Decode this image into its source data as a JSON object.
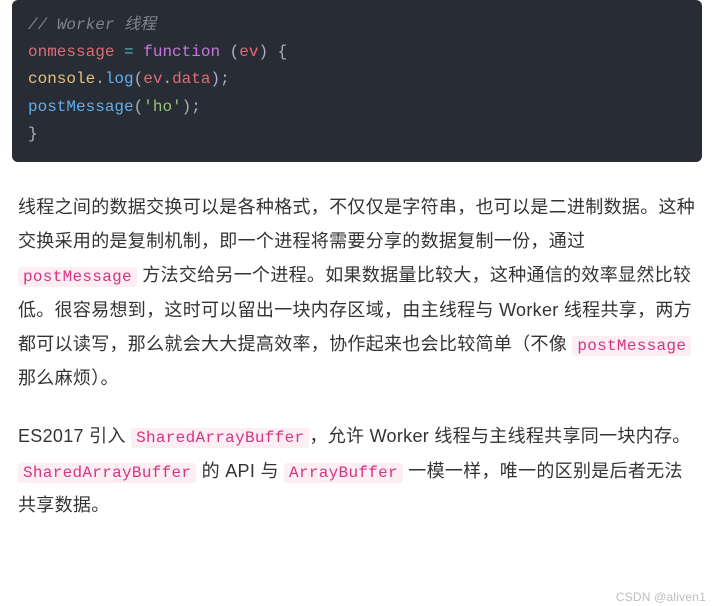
{
  "code": {
    "comment_prefix": "// ",
    "comment_text": "Worker 线程",
    "line2_lhs": "onmessage",
    "line2_op": " = ",
    "line2_kw": "function",
    "line2_paren_open": " (",
    "line2_arg": "ev",
    "line2_paren_close": ") {",
    "line3_indent": "   ",
    "line3_console": "console",
    "line3_dot1": ".",
    "line3_log": "log",
    "line3_open": "(",
    "line3_ev": "ev",
    "line3_dot2": ".",
    "line3_data": "data",
    "line3_close": ");",
    "line4_indent": "   ",
    "line4_fn": "postMessage",
    "line4_open": "(",
    "line4_str": "'ho'",
    "line4_close": ");",
    "line5_close": "}"
  },
  "para1": {
    "seg1": "线程之间的数据交换可以是各种格式，不仅仅是字符串，也可以是二进制数据。这种交换采用的是复制机制，即一个进程将需要分享的数据复制一份，通过 ",
    "code1": "postMessage",
    "seg2": " 方法交给另一个进程。如果数据量比较大，这种通信的效率显然比较低。很容易想到，这时可以留出一块内存区域，由主线程与 Worker 线程共享，两方都可以读写，那么就会大大提高效率，协作起来也会比较简单（不像 ",
    "code2": "postMessage",
    "seg3": " 那么麻烦）。"
  },
  "para2": {
    "seg1": "ES2017 引入 ",
    "code1": "SharedArrayBuffer",
    "seg2": "，允许 Worker 线程与主线程共享同一块内存。",
    "code2": "SharedArrayBuffer",
    "seg3": " 的 API 与 ",
    "code3": "ArrayBuffer",
    "seg4": " 一模一样，唯一的区别是后者无法共享数据。"
  },
  "watermark": "CSDN @aliven1"
}
